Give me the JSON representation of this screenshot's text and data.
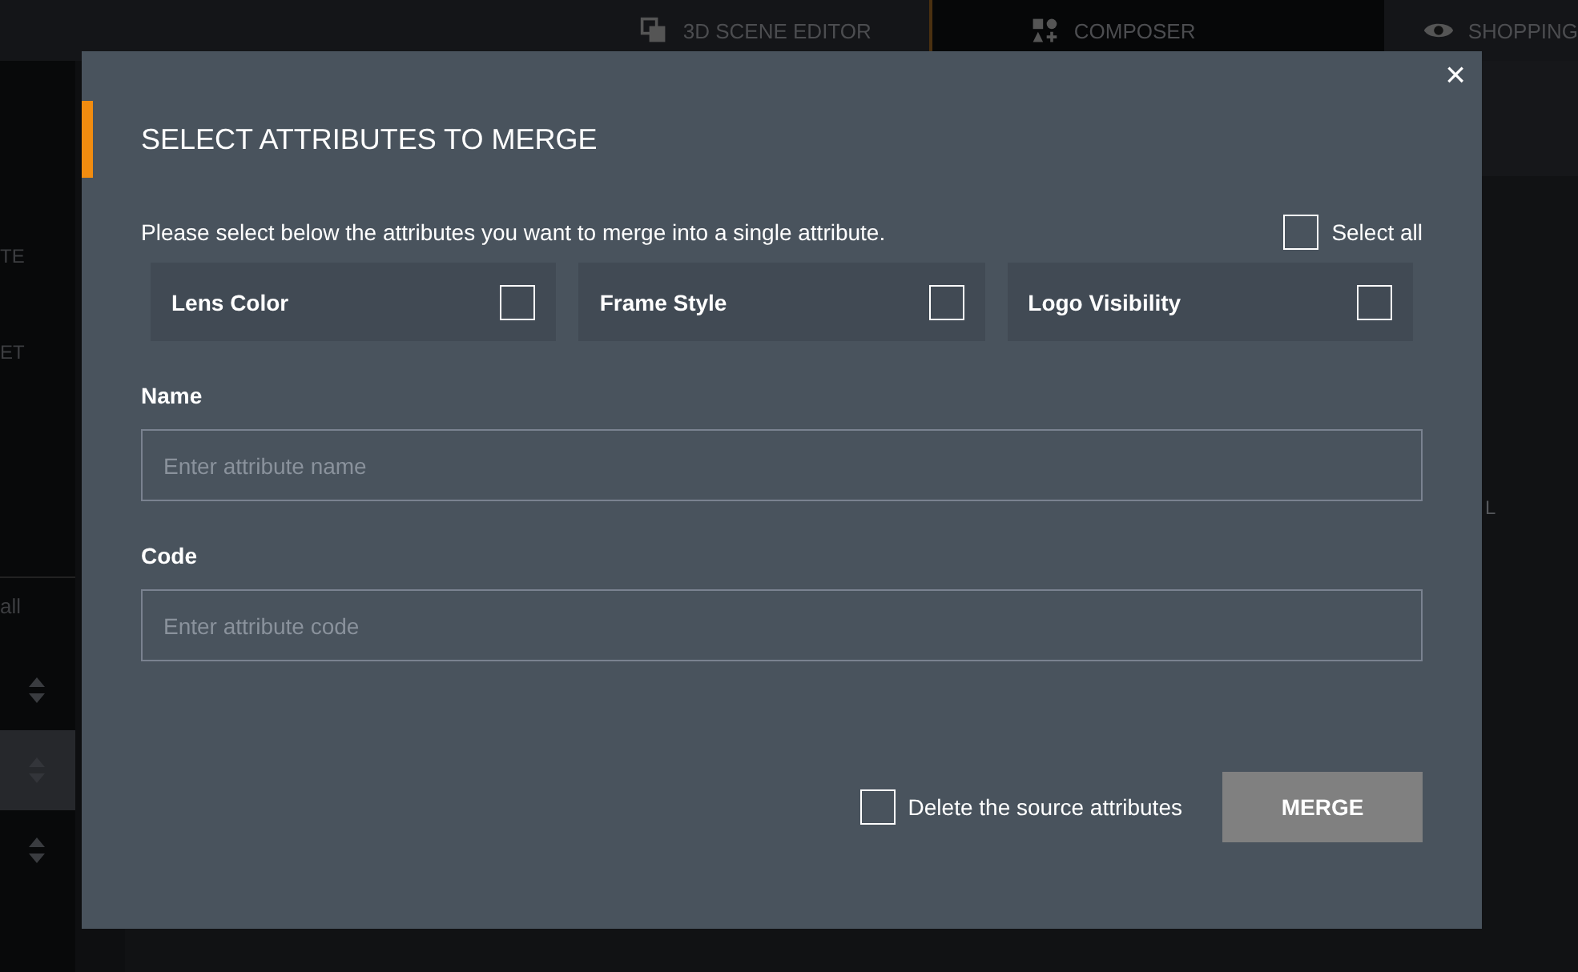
{
  "app_tabs": [
    {
      "label": "3D SCENE EDITOR",
      "selected": false
    },
    {
      "label": "COMPOSER",
      "selected": true
    },
    {
      "label": "SHOPPING",
      "selected": false
    }
  ],
  "sidebar": {
    "labels": [
      "TE",
      "ET"
    ],
    "filter_label": "all",
    "rows": [
      {
        "selected": false
      },
      {
        "selected": true
      },
      {
        "selected": false
      }
    ]
  },
  "right_panel": {
    "label": "L"
  },
  "dialog": {
    "title": "SELECT ATTRIBUTES TO MERGE",
    "close": "×",
    "intro": "Please select below the attributes you want to merge into a single attribute.",
    "select_all": {
      "label": "Select all",
      "checked": false
    },
    "attributes": [
      {
        "label": "Lens Color",
        "checked": false
      },
      {
        "label": "Frame Style",
        "checked": false
      },
      {
        "label": "Logo Visibility",
        "checked": false
      }
    ],
    "fields": [
      {
        "label": "Name",
        "placeholder": "Enter attribute name"
      },
      {
        "label": "Code",
        "placeholder": "Enter attribute code"
      }
    ],
    "delete_source": {
      "label": "Delete the source attributes",
      "checked": false
    },
    "merge_button": "MERGE"
  }
}
